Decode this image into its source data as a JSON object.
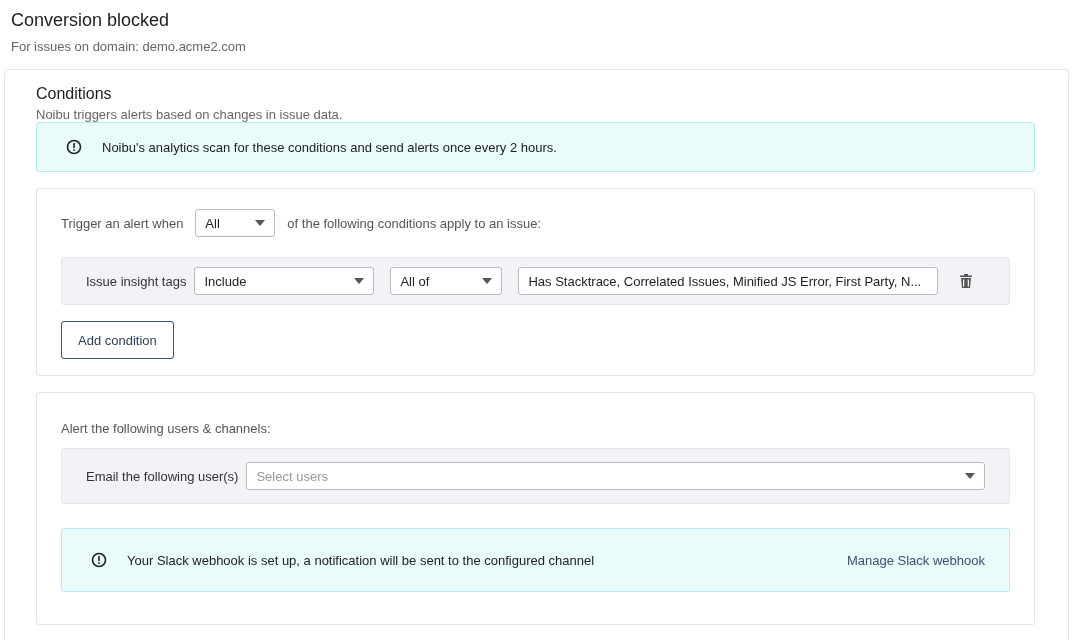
{
  "page": {
    "title": "Conversion blocked",
    "subtitle": "For issues on domain: demo.acme2.com"
  },
  "conditions": {
    "heading": "Conditions",
    "description": "Noibu triggers alerts based on changes in issue data.",
    "notice": "Noibu's analytics scan for these conditions and send alerts once every 2 hours.",
    "trigger": {
      "prefix": "Trigger an alert when",
      "match": "All",
      "suffix": "of the following conditions apply to an issue:"
    },
    "rows": [
      {
        "label": "Issue insight tags",
        "operator": "Include",
        "quantifier": "All of",
        "values": "Has Stacktrace, Correlated Issues, Minified JS Error, First Party, N..."
      }
    ],
    "add_button": "Add condition"
  },
  "alerts": {
    "heading": "Alert the following users & channels:",
    "email_label": "Email the following user(s)",
    "email_placeholder": "Select users",
    "slack_notice": "Your Slack webhook is set up, a notification will be sent to the configured channel",
    "slack_link": "Manage Slack webhook"
  }
}
